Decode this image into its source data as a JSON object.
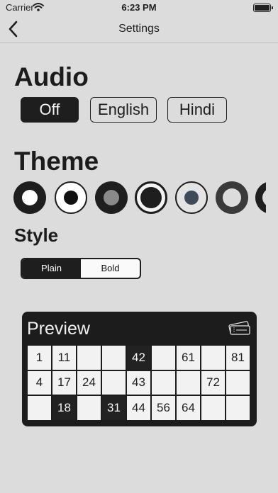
{
  "status": {
    "carrier": "Carrier",
    "time": "6:23 PM"
  },
  "nav": {
    "title": "Settings"
  },
  "audio": {
    "heading": "Audio",
    "options": [
      "Off",
      "English",
      "Hindi"
    ],
    "selected": "Off"
  },
  "theme": {
    "heading": "Theme",
    "options": [
      {
        "name": "theme-1",
        "ring": "#1e1e1e",
        "fill": "#ffffff"
      },
      {
        "name": "theme-2",
        "ring": "#1e1e1e",
        "fill": "#ffffff"
      },
      {
        "name": "theme-3",
        "ring": "#1e1e1e",
        "fill": "#8a8a8a"
      },
      {
        "name": "theme-4",
        "ring": "#1e1e1e",
        "fill": "#ffffff"
      },
      {
        "name": "theme-5",
        "ring": "#1e1e1e",
        "fill": "#3e4a59"
      },
      {
        "name": "theme-6",
        "ring": "#3a3a3a",
        "fill": "#e6e6e6"
      },
      {
        "name": "theme-7",
        "ring": "#1e1e1e",
        "fill": "#ffffff"
      }
    ]
  },
  "style": {
    "heading": "Style",
    "options": [
      "Plain",
      "Bold"
    ],
    "selected": "Plain"
  },
  "preview": {
    "title": "Preview",
    "ticket_icon": "ticket-icon",
    "rows": [
      [
        {
          "v": "1"
        },
        {
          "v": "11"
        },
        {
          "v": ""
        },
        {
          "v": ""
        },
        {
          "v": "42",
          "marked": true
        },
        {
          "v": ""
        },
        {
          "v": "61"
        },
        {
          "v": ""
        },
        {
          "v": "81"
        }
      ],
      [
        {
          "v": "4"
        },
        {
          "v": "17"
        },
        {
          "v": "24"
        },
        {
          "v": ""
        },
        {
          "v": "43"
        },
        {
          "v": ""
        },
        {
          "v": ""
        },
        {
          "v": "72"
        },
        {
          "v": ""
        }
      ],
      [
        {
          "v": ""
        },
        {
          "v": "18",
          "marked": true
        },
        {
          "v": ""
        },
        {
          "v": "31",
          "marked": true
        },
        {
          "v": "44"
        },
        {
          "v": "56"
        },
        {
          "v": "64"
        },
        {
          "v": ""
        },
        {
          "v": ""
        }
      ]
    ]
  },
  "icons": {
    "back": "chevron-left-icon",
    "wifi": "wifi-icon",
    "battery": "battery-icon"
  }
}
